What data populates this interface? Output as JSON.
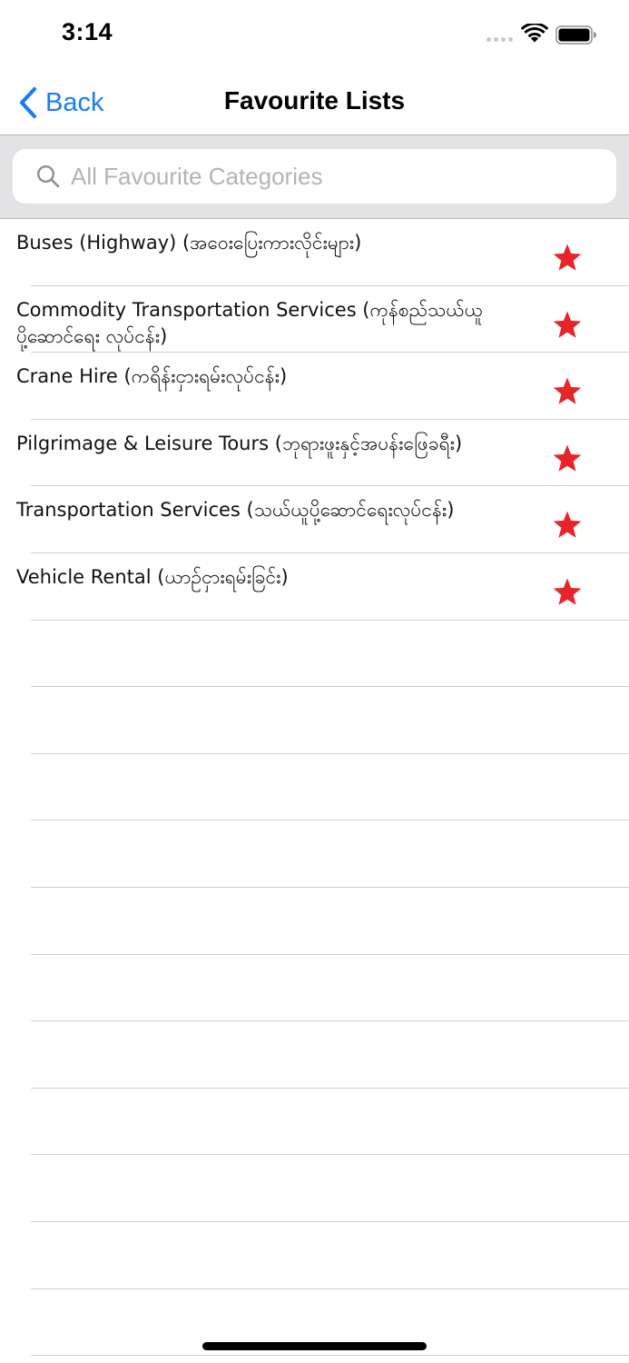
{
  "status_bar": {
    "time": "3:14"
  },
  "nav": {
    "back_label": "Back",
    "title": "Favourite Lists"
  },
  "search": {
    "placeholder": "All Favourite Categories",
    "value": ""
  },
  "colors": {
    "accent": "#1a7cf5",
    "star": "#e8242b"
  },
  "list": {
    "items": [
      {
        "label": "Buses (Highway) (အဝေးပြေးကားလိုင်းများ)",
        "favourite": true,
        "icon": "star-icon"
      },
      {
        "label": "Commodity Transportation Services (ကုန်စည်သယ်ယူ ပို့ဆောင်ရေး လုပ်ငန်း)",
        "favourite": true,
        "icon": "star-icon"
      },
      {
        "label": "Crane Hire (ကရိန်းငှားရမ်းလုပ်ငန်း)",
        "favourite": true,
        "icon": "star-icon"
      },
      {
        "label": "Pilgrimage & Leisure Tours (ဘုရားဖူးနှင့်အပန်းဖြေခရီး)",
        "favourite": true,
        "icon": "star-icon"
      },
      {
        "label": "Transportation Services (သယ်ယူပို့ဆောင်ရေးလုပ်ငန်း)",
        "favourite": true,
        "icon": "star-icon"
      },
      {
        "label": "Vehicle Rental (ယာဉ်ငှားရမ်းခြင်း)",
        "favourite": true,
        "icon": "star-icon"
      }
    ]
  }
}
